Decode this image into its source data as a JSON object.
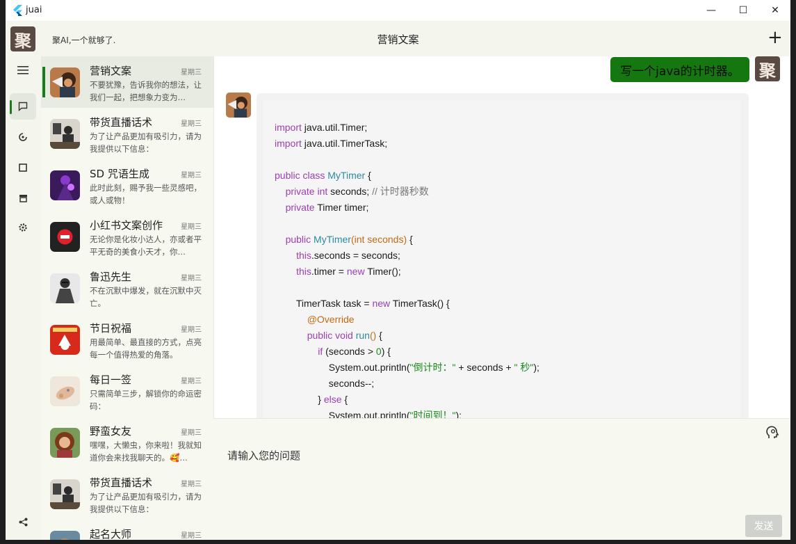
{
  "window": {
    "title": "juai",
    "minimize": "—",
    "maximize": "☐",
    "close": "✕"
  },
  "header": {
    "avatar_char": "聚",
    "slogan": "聚AI,一个就够了.",
    "page_title": "营销文案",
    "new_label": "+"
  },
  "rail": {
    "items": [
      "menu-icon",
      "chat-icon",
      "refresh-icon",
      "square-icon",
      "store-icon",
      "settings-icon"
    ],
    "share": "share-icon"
  },
  "chats": [
    {
      "name": "营销文案",
      "day": "星期三",
      "preview": "不要犹豫，告诉我你的想法，让我们一起，把想象力变为…",
      "active": true
    },
    {
      "name": "带货直播话术",
      "day": "星期三",
      "preview": "为了让产品更加有吸引力，请为我提供以下信息："
    },
    {
      "name": "SD 咒语生成",
      "day": "星期三",
      "preview": "此时此刻，赐予我一些灵感吧，或人或物！"
    },
    {
      "name": "小红书文案创作",
      "day": "星期三",
      "preview": "无论你是化妆小达人，亦或者平平无奇的美食小天才，你…"
    },
    {
      "name": "鲁迅先生",
      "day": "星期三",
      "preview": "不在沉默中爆发，就在沉默中灭亡。"
    },
    {
      "name": "节日祝福",
      "day": "星期三",
      "preview": "用最简单、最直接的方式，点亮每一个值得热爱的角落。"
    },
    {
      "name": "每日一签",
      "day": "星期三",
      "preview": "只需简单三步，解锁你的命运密码："
    },
    {
      "name": "野蛮女友",
      "day": "星期三",
      "preview": "嘿嘿，大懒虫，你来啦！我就知道你会来找我聊天的。🥰…"
    },
    {
      "name": "带货直播话术",
      "day": "星期三",
      "preview": "为了让产品更加有吸引力，请为我提供以下信息："
    },
    {
      "name": "起名大师",
      "day": "星期三",
      "preview": ""
    }
  ],
  "conversation": {
    "user_message": "写一个java的计时器。",
    "user_avatar_char": "聚",
    "code": {
      "l1": "import java.util.Timer;",
      "l2": "import java.util.TimerTask;",
      "l3": "public class MyTimer {",
      "l4": "private int seconds; // 计时器秒数",
      "l5": "private Timer timer;",
      "l6": "public MyTimer(int seconds) {",
      "l7": "this.seconds = seconds;",
      "l8": "this.timer = new Timer();",
      "l9": "TimerTask task = new TimerTask() {",
      "l10": "@Override",
      "l11": "public void run() {",
      "l12": "if (seconds > 0) {",
      "l13": "System.out.println(\"倒计时：\" + seconds + \" 秒\");",
      "l14": "seconds--;",
      "l15": "} else {",
      "l16": "System.out.println(\"时间到！\");"
    }
  },
  "compose": {
    "placeholder": "请输入您的问题",
    "send_label": "发送",
    "icon": "brain-head-icon"
  }
}
